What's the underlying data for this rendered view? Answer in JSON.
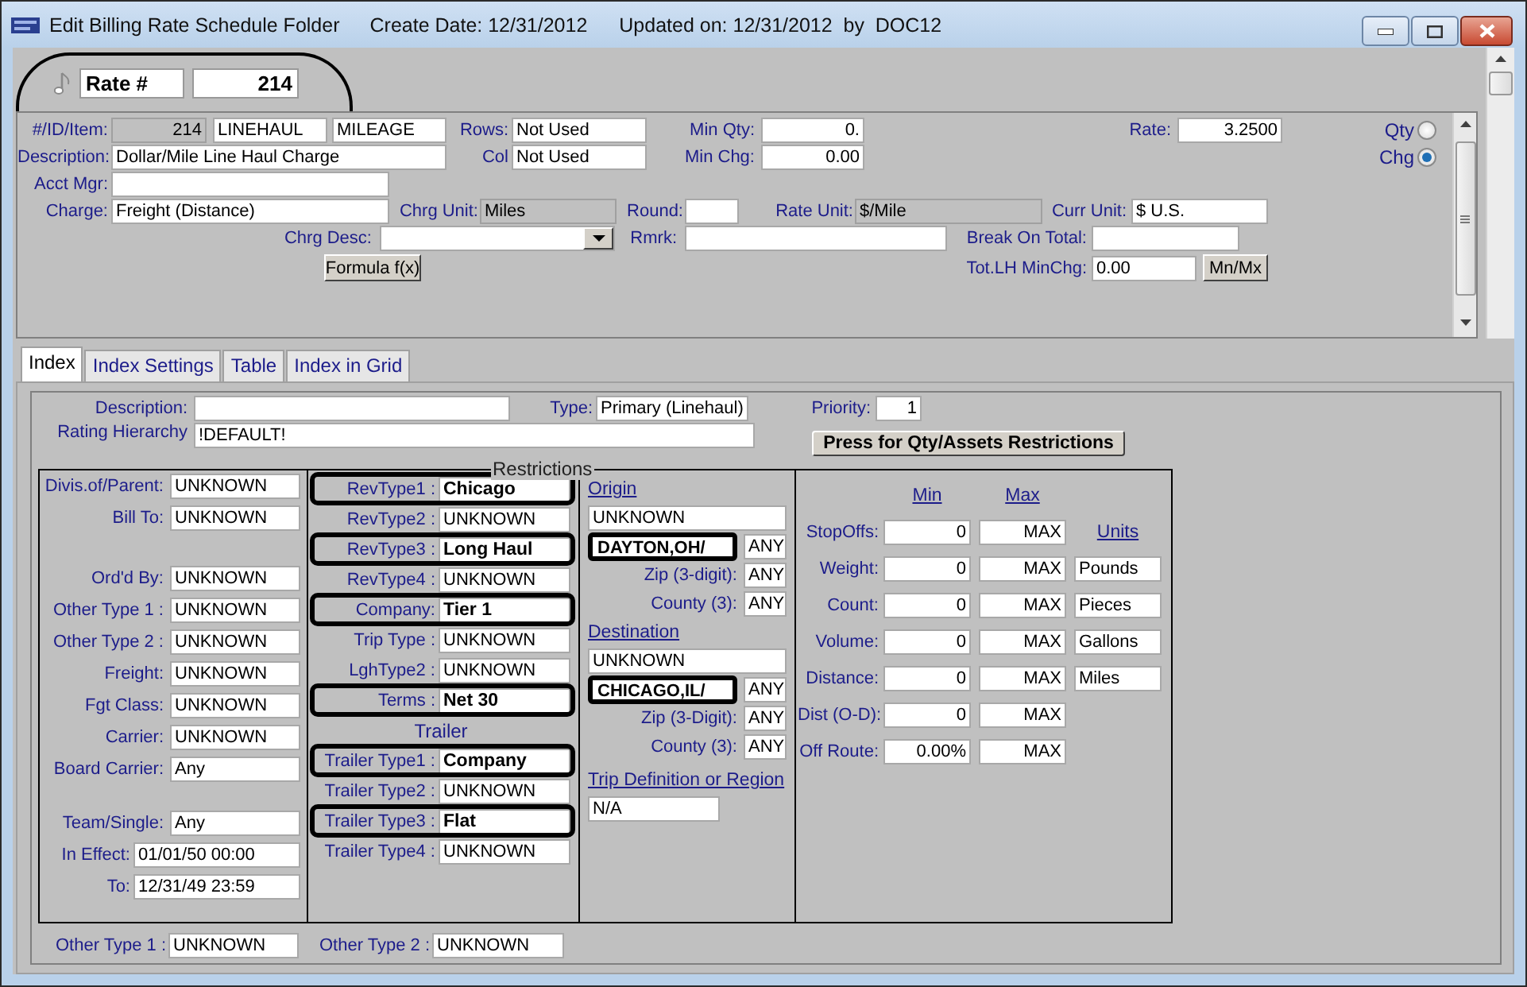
{
  "window": {
    "title": "Edit Billing Rate Schedule Folder",
    "create_date": "Create Date: 12/31/2012",
    "updated": "Updated on: 12/31/2012  by  DOC12"
  },
  "rate_header": {
    "label": "Rate #",
    "number": "214"
  },
  "header_form": {
    "item": {
      "label": "#/ID/Item:",
      "fields": [
        {
          "value": "214",
          "read_only": true
        },
        {
          "value": "LINEHAUL",
          "read_only": false
        },
        {
          "value": "MILEAGE",
          "read_only": false
        }
      ]
    },
    "rows": {
      "label": "Rows:",
      "value": "Not Used"
    },
    "min_qty": {
      "label": "Min Qty:",
      "value": "0."
    },
    "rate": {
      "label": "Rate:",
      "value": "3.2500"
    },
    "rate_basis": [
      {
        "label": "Qty",
        "selected": false
      },
      {
        "label": "Chg",
        "selected": true
      }
    ],
    "description": {
      "label": "Description:",
      "value": "Dollar/Mile Line Haul Charge"
    },
    "col": {
      "label": "Col",
      "value": "Not Used"
    },
    "min_chg": {
      "label": "Min Chg:",
      "value": "0.00"
    },
    "acct_mgr": {
      "label": "Acct Mgr:"
    },
    "charge": {
      "label": "Charge:",
      "value": "Freight (Distance)"
    },
    "chrg_unit": {
      "label": "Chrg Unit:",
      "value": "Miles",
      "read_only": true
    },
    "round": {
      "label": "Round:"
    },
    "rate_unit": {
      "label": "Rate Unit:",
      "value": "$/Mile",
      "read_only": true
    },
    "curr_unit": {
      "label": "Curr Unit:",
      "value": "$ U.S."
    },
    "chrg_desc": {
      "label": "Chrg Desc:"
    },
    "rmrk": {
      "label": "Rmrk:"
    },
    "break_on_total": {
      "label": "Break On Total:"
    },
    "formula_button": "Formula f(x)",
    "tot_lh_minchg": {
      "label": "Tot.LH MinChg:",
      "value": "0.00"
    },
    "minmax_button": "Mn/Mx"
  },
  "tabs": [
    {
      "label": "Index",
      "selected": true
    },
    {
      "label": "Index Settings",
      "selected": false
    },
    {
      "label": "Table",
      "selected": false
    },
    {
      "label": "Index in Grid",
      "selected": false
    }
  ],
  "index": {
    "description": {
      "label": "Description:"
    },
    "type": {
      "label": "Type:",
      "value": "Primary (Linehaul)"
    },
    "priority": {
      "label": "Priority:",
      "value": "1"
    },
    "rating_hierarchy": {
      "label": "Rating Hierarchy",
      "value": "!DEFAULT!"
    },
    "restrictions_button": "Press for Qty/Assets Restrictions",
    "restrictions": {
      "title": "Restrictions",
      "general": [
        [
          {
            "label": "Divis.of/Parent:",
            "value": "UNKNOWN"
          },
          {
            "label": "Bill To:",
            "value": "UNKNOWN"
          }
        ],
        [
          {
            "label": "Ord'd By:",
            "value": "UNKNOWN"
          },
          {
            "label": "Other Type 1 :",
            "value": "UNKNOWN"
          },
          {
            "label": "Other Type 2 :",
            "value": "UNKNOWN"
          },
          {
            "label": "Freight:",
            "value": "UNKNOWN"
          },
          {
            "label": "Fgt Class:",
            "value": "UNKNOWN"
          },
          {
            "label": "Carrier:",
            "value": "UNKNOWN"
          },
          {
            "label": "Board Carrier:",
            "value": "Any"
          }
        ],
        [
          {
            "label": "Team/Single:",
            "value": "Any"
          },
          {
            "label": "In Effect:",
            "value": "01/01/50 00:00"
          },
          {
            "label": "To:",
            "value": "12/31/49 23:59"
          }
        ]
      ],
      "revenue": [
        {
          "label": "RevType1 :",
          "value": "Chicago",
          "highlighted": true
        },
        {
          "label": "RevType2 :",
          "value": "UNKNOWN",
          "highlighted": false
        },
        {
          "label": "RevType3 :",
          "value": "Long Haul",
          "highlighted": true
        },
        {
          "label": "RevType4 :",
          "value": "UNKNOWN",
          "highlighted": false
        },
        {
          "label": "Company:",
          "value": "Tier 1",
          "highlighted": true
        },
        {
          "label": "Trip Type :",
          "value": "UNKNOWN",
          "highlighted": false
        },
        {
          "label": "LghType2 :",
          "value": "UNKNOWN",
          "highlighted": false
        },
        {
          "label": "Terms :",
          "value": "Net 30",
          "highlighted": true
        }
      ],
      "trailer": {
        "title": "Trailer",
        "items": [
          {
            "label": "Trailer Type1 :",
            "value": "Company",
            "highlighted": true
          },
          {
            "label": "Trailer Type2 :",
            "value": "UNKNOWN",
            "highlighted": false
          },
          {
            "label": "Trailer Type3 :",
            "value": "Flat",
            "highlighted": true
          },
          {
            "label": "Trailer Type4 :",
            "value": "UNKNOWN",
            "highlighted": false
          }
        ]
      },
      "origin": {
        "title": "Origin",
        "name": "UNKNOWN",
        "city": {
          "value": "DAYTON,OH/",
          "highlighted": true
        },
        "city_code": "ANY",
        "zip": {
          "label": "Zip (3-digit):",
          "value": "ANY"
        },
        "county": {
          "label": "County (3):",
          "value": "ANY"
        }
      },
      "destination": {
        "title": "Destination",
        "name": "UNKNOWN",
        "city": {
          "value": "CHICAGO,IL/",
          "highlighted": true
        },
        "city_code": "ANY",
        "zip": {
          "label": "Zip (3-Digit):",
          "value": "ANY"
        },
        "county": {
          "label": "County (3):",
          "value": "ANY"
        }
      },
      "trip_definition": {
        "title": "Trip Definition or Region",
        "value": "N/A"
      },
      "limits": {
        "min_header": "Min",
        "max_header": "Max",
        "units_header": "Units",
        "rows": [
          {
            "label": "StopOffs:",
            "min": "0",
            "max": "MAX"
          },
          {
            "label": "Weight:",
            "min": "0",
            "max": "MAX",
            "unit": "Pounds"
          },
          {
            "label": "Count:",
            "min": "0",
            "max": "MAX",
            "unit": "Pieces"
          },
          {
            "label": "Volume:",
            "min": "0",
            "max": "MAX",
            "unit": "Gallons"
          },
          {
            "label": "Distance:",
            "min": "0",
            "max": "MAX",
            "unit": "Miles"
          },
          {
            "label": "Dist (O-D):",
            "min": "0",
            "max": "MAX"
          },
          {
            "label": "Off Route:",
            "min": "0.00%",
            "max": "MAX"
          }
        ]
      }
    },
    "other_types": [
      {
        "label": "Other Type 1 :",
        "value": "UNKNOWN"
      },
      {
        "label": "Other Type 2 :",
        "value": "UNKNOWN"
      }
    ]
  }
}
